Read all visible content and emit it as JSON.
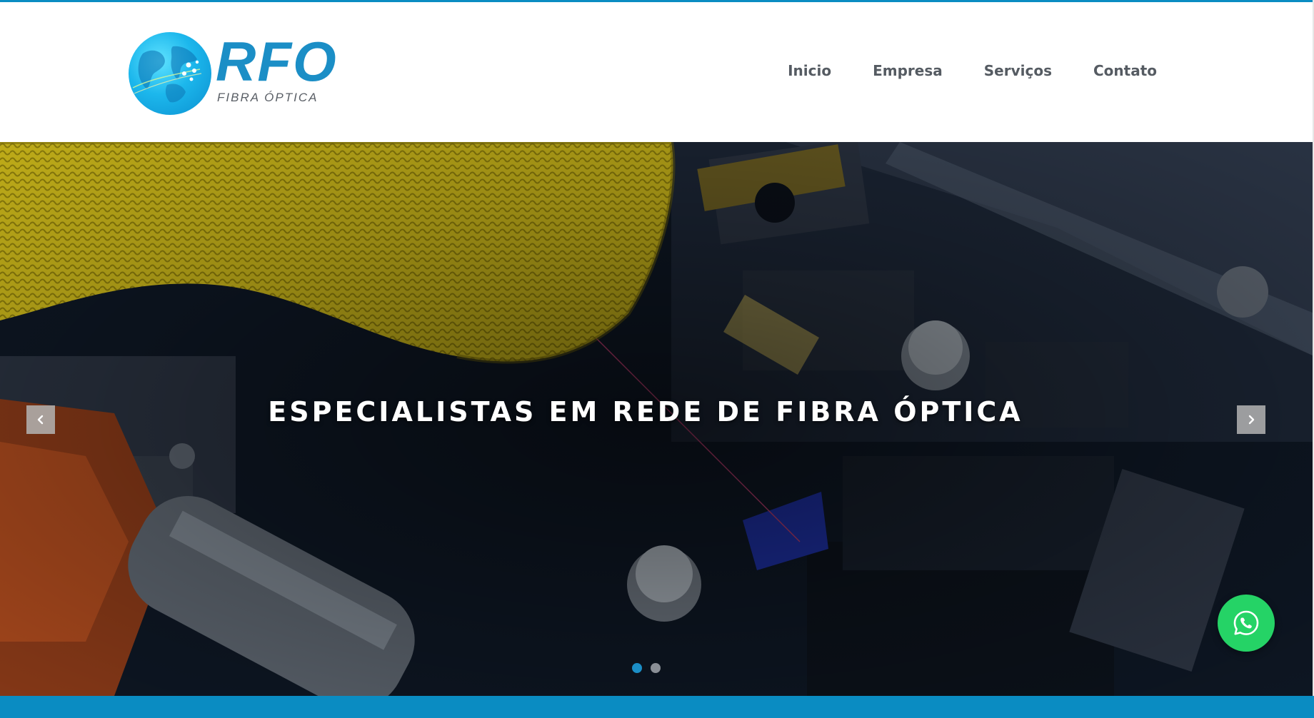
{
  "brand": {
    "logo_mark": "RFO",
    "logo_subtitle": "FIBRA ÓPTICA",
    "primary_color": "#1b8ec6",
    "accent_band_color": "#0a8cc2"
  },
  "nav": {
    "items": [
      {
        "label": "Inicio"
      },
      {
        "label": "Empresa"
      },
      {
        "label": "Serviços"
      },
      {
        "label": "Contato"
      }
    ]
  },
  "hero": {
    "title": "ESPECIALISTAS EM REDE DE FIBRA ÓPTICA",
    "slide_count": 2,
    "active_slide": 1,
    "prev_icon": "chevron-left-icon",
    "next_icon": "chevron-right-icon"
  },
  "floating": {
    "whatsapp_icon": "whatsapp-icon",
    "whatsapp_color": "#25d366"
  }
}
